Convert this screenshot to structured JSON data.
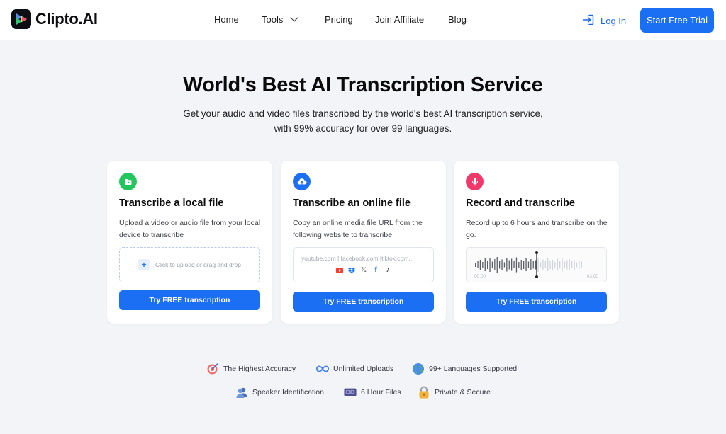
{
  "brand": {
    "name": "Clipto.AI"
  },
  "nav": {
    "items": [
      "Home",
      "Tools",
      "Pricing",
      "Join Affiliate",
      "Blog"
    ],
    "login": "Log In",
    "cta": "Start Free Trial"
  },
  "hero": {
    "title": "World's Best AI Transcription Service",
    "subtitle_line1": "Get your audio and video files transcribed by the world's best AI transcription service,",
    "subtitle_line2": "with 99% accuracy for over 99 languages."
  },
  "cards": [
    {
      "title": "Transcribe a local file",
      "desc": "Upload a video or audio file from your local device to transcribe",
      "dropzone_label": "Click to upload or drag and drop",
      "button": "Try FREE transcription",
      "icon": "folder-icon",
      "color": "#22c55e"
    },
    {
      "title": "Transcribe an online file",
      "desc": "Copy an online media file URL from the following website to transcribe",
      "url_placeholder": "youtube.com | facebook.com |tiktok.com...",
      "sites": [
        "youtube-icon",
        "dropbox-icon",
        "x-icon",
        "facebook-icon",
        "tiktok-icon"
      ],
      "button": "Try FREE transcription",
      "icon": "cloud-upload-icon",
      "color": "#1b6ff2"
    },
    {
      "title": "Record and transcribe",
      "desc": "Record up to 6 hours and transcribe on the go.",
      "time_start": "00:00",
      "time_end": "03:00",
      "button": "Try FREE transcription",
      "icon": "microphone-icon",
      "color": "#f0386b"
    }
  ],
  "features": [
    {
      "label": "The Highest Accuracy",
      "icon": "target-icon"
    },
    {
      "label": "Unlimited Uploads",
      "icon": "infinity-icon"
    },
    {
      "label": "99+ Languages Supported",
      "icon": "globe-icon"
    },
    {
      "label": "Speaker Identification",
      "icon": "speaker-icon"
    },
    {
      "label": "6 Hour Files",
      "icon": "tape-icon"
    },
    {
      "label": "Private & Secure",
      "icon": "lock-icon"
    }
  ],
  "colors": {
    "accent": "#1b6ff2",
    "background": "#f3f4f8"
  }
}
